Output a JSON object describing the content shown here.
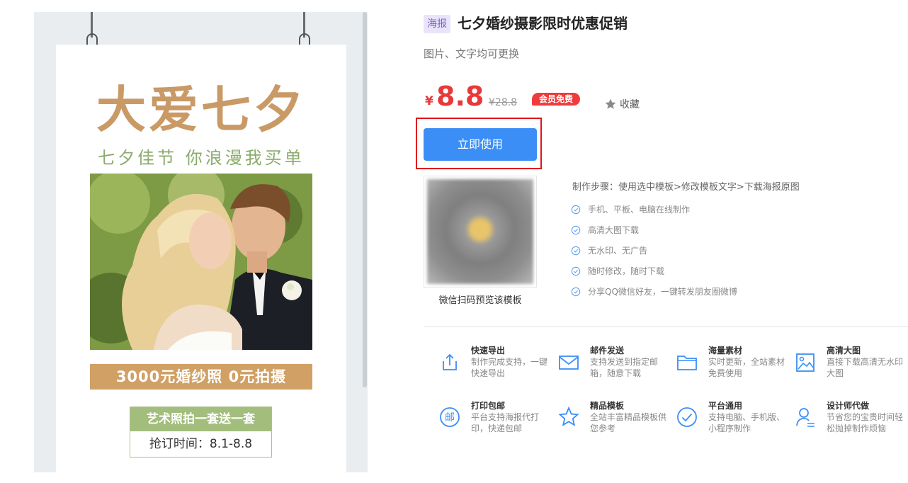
{
  "poster": {
    "title": "大爱七夕",
    "subtitle": "七夕佳节 你浪漫我买单",
    "banner": "3000元婚纱照 0元拍摄",
    "box_header": "艺术照拍一套送一套",
    "box_body": "抢订时间：8.1-8.8"
  },
  "product": {
    "tag": "海报",
    "title": "七夕婚纱摄影限时优惠促销",
    "subtitle": "图片、文字均可更换",
    "currency": "¥",
    "price": "8.8",
    "original_price": "¥28.8",
    "member_badge": "会员免费",
    "favorite_label": "收藏",
    "use_button": "立即使用",
    "qr_caption": "微信扫码预览该模板"
  },
  "steps": {
    "title": "制作步骤：使用选中模板>修改模板文字>下载海报原图",
    "items": [
      "手机、平板、电脑在线制作",
      "高清大图下载",
      "无水印、无广告",
      "随时修改，随时下载",
      "分享QQ微信好友，一键转发朋友圈微博"
    ]
  },
  "features": [
    {
      "title": "快速导出",
      "desc": "制作完成支持，一键快速导出",
      "icon": "export-icon"
    },
    {
      "title": "邮件发送",
      "desc": "支持发送到指定邮箱，随意下载",
      "icon": "mail-icon"
    },
    {
      "title": "海量素材",
      "desc": "实时更新，全站素材免费使用",
      "icon": "folder-icon"
    },
    {
      "title": "高清大图",
      "desc": "直接下载高清无水印大图",
      "icon": "image-icon"
    },
    {
      "title": "打印包邮",
      "desc": "平台支持海报代打印，快递包邮",
      "icon": "post-icon"
    },
    {
      "title": "精品模板",
      "desc": "全站丰富精品模板供您参考",
      "icon": "star-icon"
    },
    {
      "title": "平台通用",
      "desc": "支持电脑、手机版、小程序制作",
      "icon": "check-circle-icon"
    },
    {
      "title": "设计师代做",
      "desc": "节省您的宝贵时间轻松抛掉制作烦恼",
      "icon": "designer-icon"
    }
  ],
  "colors": {
    "accent": "#3a8ef6",
    "price_red": "#e8393a",
    "poster_gold": "#c99a66",
    "poster_green": "#8bab6c"
  }
}
